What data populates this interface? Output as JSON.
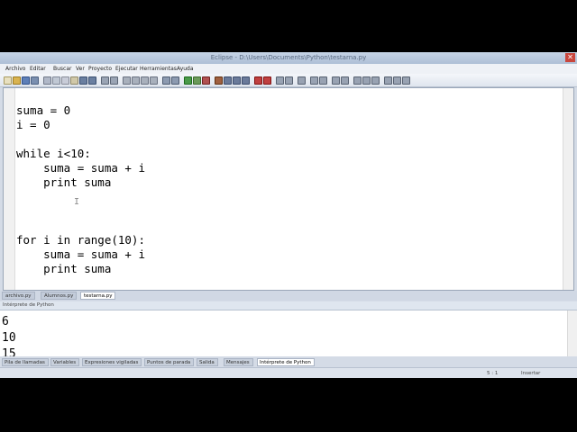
{
  "window": {
    "title": "Eclipse - D:\\Users\\Documents\\Python\\testarna.py"
  },
  "menu": [
    "Archivo",
    "Editar",
    "Buscar",
    "Ver",
    "Proyecto",
    "Ejecutar",
    "Herramientas",
    "Ayuda"
  ],
  "editor": {
    "lines": [
      "suma = 0",
      "i = 0",
      "",
      "while i<10:",
      "    suma = suma + i",
      "    print suma",
      "",
      "",
      "",
      "for i in range(10):",
      "    suma = suma + i",
      "    print suma"
    ]
  },
  "doc_tabs": [
    "archivo.py",
    "Alumnos.py",
    "testarna.py"
  ],
  "console": {
    "title": "Intérprete de Python",
    "output": [
      "6",
      "10",
      "15"
    ]
  },
  "panel_tabs": [
    "Pila de llamadas",
    "Variables",
    "Expresiones vigiladas",
    "Puntos de parada",
    "Salida",
    "Mensajes",
    "Intérprete de Python"
  ],
  "status": {
    "left": "",
    "pos": "5 : 1",
    "mode": "Insertar"
  },
  "colors": {
    "window_bg": "#d4dbe6",
    "editor_bg": "#ffffff",
    "outer_bg": "#000000"
  }
}
